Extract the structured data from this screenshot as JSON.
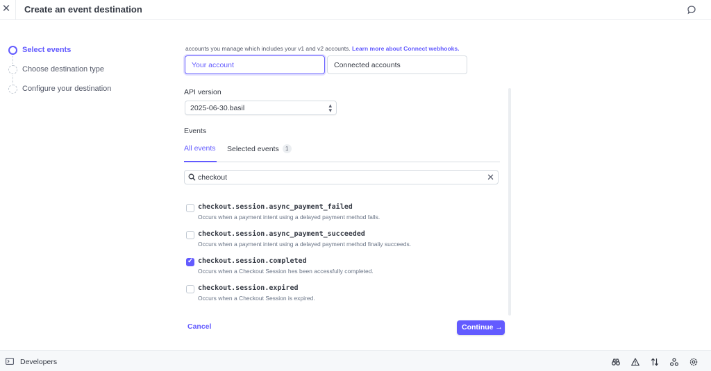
{
  "header": {
    "close_icon": "close-icon",
    "title": "Create an event destination",
    "feedback_icon": "chat-bubble-icon"
  },
  "steps": [
    {
      "label": "Select events",
      "state": "active"
    },
    {
      "label": "Choose destination type",
      "state": "pending"
    },
    {
      "label": "Configure your destination",
      "state": "pending"
    }
  ],
  "intro": {
    "text": "accounts you manage which includes your v1 and v2 accounts. ",
    "link": "Learn more about Connect webhooks."
  },
  "account_scope": {
    "options": [
      "Your account",
      "Connected accounts"
    ],
    "selected": "Your account"
  },
  "api_version": {
    "label": "API version",
    "value": "2025-06-30.basil"
  },
  "events": {
    "label": "Events",
    "tabs": [
      {
        "label": "All events",
        "active": true
      },
      {
        "label": "Selected events",
        "badge": "1",
        "active": false
      }
    ],
    "search": {
      "value": "checkout"
    },
    "items": [
      {
        "name": "checkout.session.async_payment_failed",
        "description": "Occurs when a payment intent using a delayed payment method falls.",
        "checked": false
      },
      {
        "name": "checkout.session.async_payment_succeeded",
        "description": "Occurs when a payment intent using a delayed payment method finaliy succeeds.",
        "checked": false
      },
      {
        "name": "checkout.session.completed",
        "description": "Occurs when a Checkout Session hes been accessfully completed.",
        "checked": true
      },
      {
        "name": "checkout.session.expired",
        "description": "Occurs when a Checkout Session is expired.",
        "checked": false
      }
    ]
  },
  "actions": {
    "cancel": "Cancel",
    "continue": "Continue →"
  },
  "footer": {
    "label": "Developers",
    "icons": [
      "binoculars-icon",
      "warning-icon",
      "sort-arrows-icon",
      "webhooks-icon",
      "settings-icon"
    ]
  },
  "colors": {
    "accent": "#635bff",
    "text": "#353a44",
    "muted": "#687385",
    "border": "#d5dbe1"
  }
}
